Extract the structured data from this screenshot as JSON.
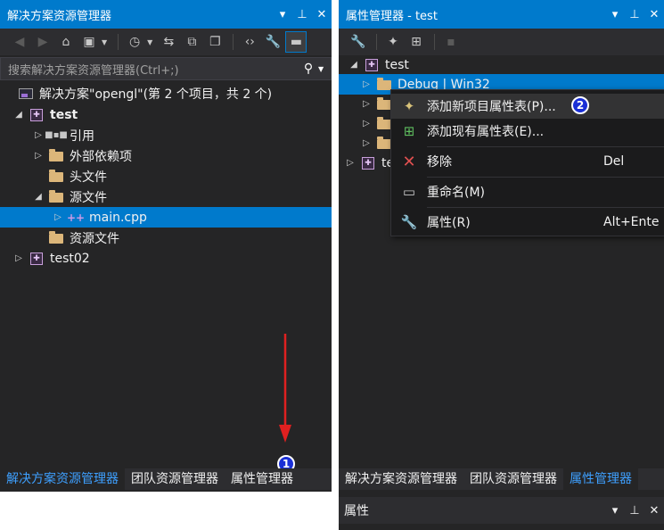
{
  "colors": {
    "accent": "#007acc",
    "panel_bg": "#252526",
    "annotation_arrow": "#e02020",
    "annotation_marker": "#1a2fd6",
    "active_tab_text": "#3ea0ff"
  },
  "solution_explorer": {
    "title": "解决方案资源管理器",
    "title_buttons": [
      "▾",
      "⊥",
      "✕"
    ],
    "search_placeholder": "搜索解决方案资源管理器(Ctrl+;)",
    "tree": {
      "solution": "解决方案\"opengl\"(第 2 个项目，共 2 个)",
      "project1": "test",
      "references": "引用",
      "external_deps": "外部依赖项",
      "header_files": "头文件",
      "source_files": "源文件",
      "main_cpp": "main.cpp",
      "resource_files": "资源文件",
      "project2": "test02"
    },
    "bottom_tabs": [
      "解决方案资源管理器",
      "团队资源管理器",
      "属性管理器"
    ],
    "marker": "1"
  },
  "property_manager": {
    "title": "属性管理器 - test",
    "title_buttons": [
      "▾",
      "⊥",
      "✕"
    ],
    "tree": {
      "project": "test",
      "config": "Debug | Win32",
      "project2_partial": "te"
    },
    "bottom_tabs": [
      "解决方案资源管理器",
      "团队资源管理器",
      "属性管理器"
    ],
    "marker": "2"
  },
  "context_menu": {
    "items": [
      {
        "icon": "new-property-sheet-icon",
        "label": "添加新项目属性表(P)...",
        "shortcut": ""
      },
      {
        "icon": "add-existing-sheet-icon",
        "label": "添加现有属性表(E)...",
        "shortcut": ""
      },
      {
        "icon": "remove-icon",
        "label": "移除",
        "shortcut": "Del"
      },
      {
        "icon": "rename-icon",
        "label": "重命名(M)",
        "shortcut": ""
      },
      {
        "icon": "wrench-icon",
        "label": "属性(R)",
        "shortcut": "Alt+Ente"
      }
    ]
  },
  "properties_panel": {
    "title": "属性",
    "title_buttons": [
      "▾",
      "⊥",
      "✕"
    ]
  }
}
